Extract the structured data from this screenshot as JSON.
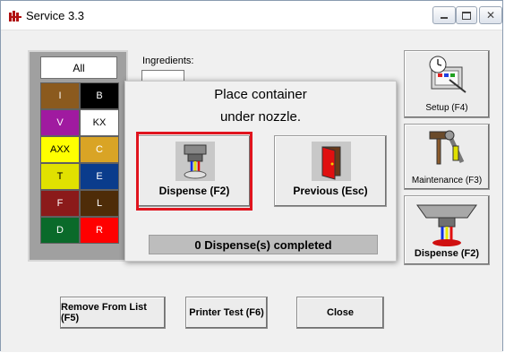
{
  "window": {
    "title": "Service 3.3"
  },
  "ingredients": {
    "label": "Ingredients:"
  },
  "palette": {
    "all_label": "All",
    "cells": [
      {
        "label": "I",
        "bg": "#8b5a1e",
        "fg": "#ffffff"
      },
      {
        "label": "B",
        "bg": "#000000",
        "fg": "#ffffff"
      },
      {
        "label": "V",
        "bg": "#a01aa0",
        "fg": "#ffffff"
      },
      {
        "label": "KX",
        "bg": "#ffffff",
        "fg": "#000000"
      },
      {
        "label": "AXX",
        "bg": "#ffff00",
        "fg": "#000000"
      },
      {
        "label": "C",
        "bg": "#d9a425",
        "fg": "#ffffff"
      },
      {
        "label": "T",
        "bg": "#e1e100",
        "fg": "#000000"
      },
      {
        "label": "E",
        "bg": "#0a3c8c",
        "fg": "#ffffff"
      },
      {
        "label": "F",
        "bg": "#8b1a1a",
        "fg": "#ffffff"
      },
      {
        "label": "L",
        "bg": "#4e2c08",
        "fg": "#ffffff"
      },
      {
        "label": "D",
        "bg": "#0a6a2a",
        "fg": "#ffffff"
      },
      {
        "label": "R",
        "bg": "#ff0000",
        "fg": "#ffffff"
      }
    ]
  },
  "sidebar": {
    "setup_label": "Setup (F4)",
    "maintenance_label": "Maintenance (F3)",
    "dispense_label": "Dispense (F2)"
  },
  "dialog": {
    "line1": "Place container",
    "line2": "under nozzle.",
    "dispense_label": "Dispense (F2)",
    "previous_label": "Previous (Esc)",
    "status": "0 Dispense(s) completed"
  },
  "footer": {
    "remove_label": "Remove From List (F5)",
    "printer_label": "Printer Test (F6)",
    "close_label": "Close"
  }
}
